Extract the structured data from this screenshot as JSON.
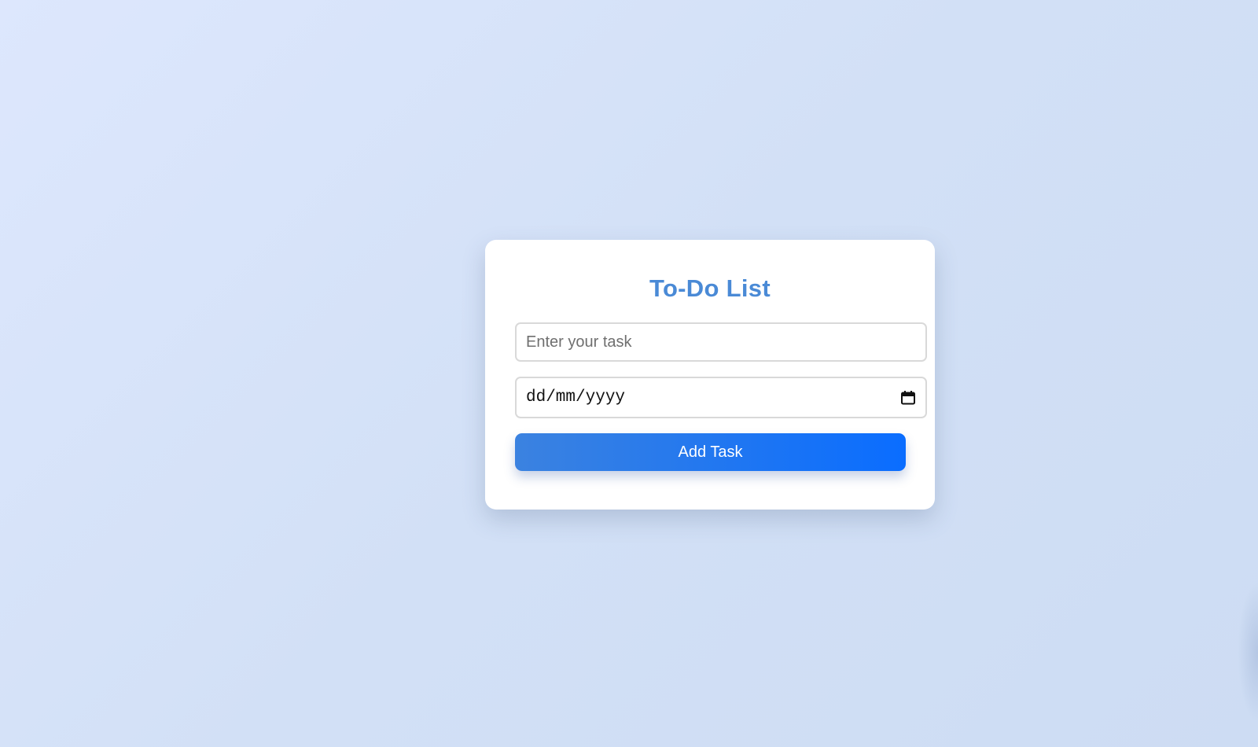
{
  "todo": {
    "title": "To-Do List",
    "task_input": {
      "placeholder": "Enter your task",
      "value": ""
    },
    "date_input": {
      "display": "dd/mm/yyyy",
      "icon": "calendar-icon"
    },
    "add_button_label": "Add Task"
  },
  "colors": {
    "title": "#4a8ad6",
    "button_gradient_start": "#3b82e0",
    "button_gradient_end": "#0a6dff",
    "background": "#d6e3fa",
    "card": "#ffffff"
  }
}
